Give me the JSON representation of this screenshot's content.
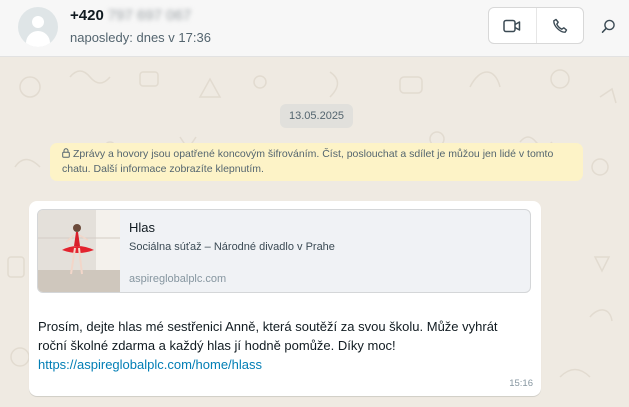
{
  "header": {
    "name_prefix": "+420",
    "name_blurred": "797 697 067",
    "status": "naposledy: dnes v 17:36",
    "icons": {
      "video": "video-call-icon",
      "voice": "phone-icon",
      "search": "search-icon"
    }
  },
  "chat": {
    "date_chip": "13.05.2025",
    "system_message": {
      "line1": "Zprávy a hovory jsou opatřené koncovým šifrováním. Číst, poslouchat a sdílet je můžou jen lidé v tomto",
      "line2": "chatu. Další informace zobrazíte klepnutím.",
      "icon": "lock-icon"
    },
    "message": {
      "preview": {
        "title": "Hlas",
        "description": "Sociálna súťaž – Národné divadlo v Prahe",
        "domain": "aspireglobalplc.com",
        "thumbnail": "ballerina-image"
      },
      "text_line1": "Prosím, dejte hlas mé sestřenici Anně, která soutěží za svou školu. Může vyhrát",
      "text_line2": "roční školné zdarma a každý hlas jí hodně pomůže. Díky moc!",
      "link": "https://aspireglobalplc.com/home/hlass",
      "time": "15:16"
    }
  },
  "colors": {
    "background": "#efeae2",
    "header": "#f7f7f7",
    "system_bg": "#fdf3c7",
    "link": "#027eb5",
    "bubble": "#ffffff"
  }
}
